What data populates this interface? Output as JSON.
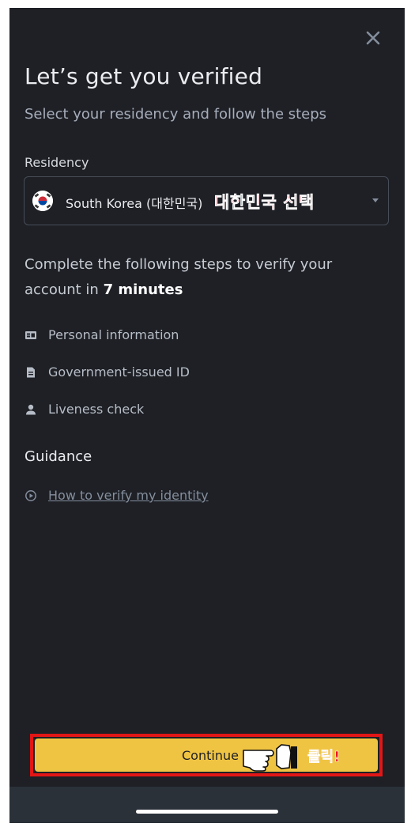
{
  "modal": {
    "title": "Let’s get you verified",
    "subtitle": "Select your residency and follow the steps"
  },
  "residency": {
    "label": "Residency",
    "selected": "South Korea (대한민국)",
    "flag_icon": "south-korea-flag-icon",
    "annotation": "대한민국 선택"
  },
  "info": {
    "text_before": "Complete the following steps to verify your account in ",
    "time": "7 minutes"
  },
  "steps": [
    {
      "label": "Personal information",
      "icon": "id-card-icon"
    },
    {
      "label": "Government-issued ID",
      "icon": "document-icon"
    },
    {
      "label": "Liveness check",
      "icon": "person-icon"
    }
  ],
  "guidance": {
    "heading": "Guidance",
    "link": "How to verify my identity",
    "link_icon": "play-circle-icon"
  },
  "footer": {
    "continue_label": "Continue",
    "click_annotation": "클릭!"
  },
  "colors": {
    "background": "#1e2026",
    "accent": "#f0c443",
    "annotation_red": "#e21616"
  }
}
